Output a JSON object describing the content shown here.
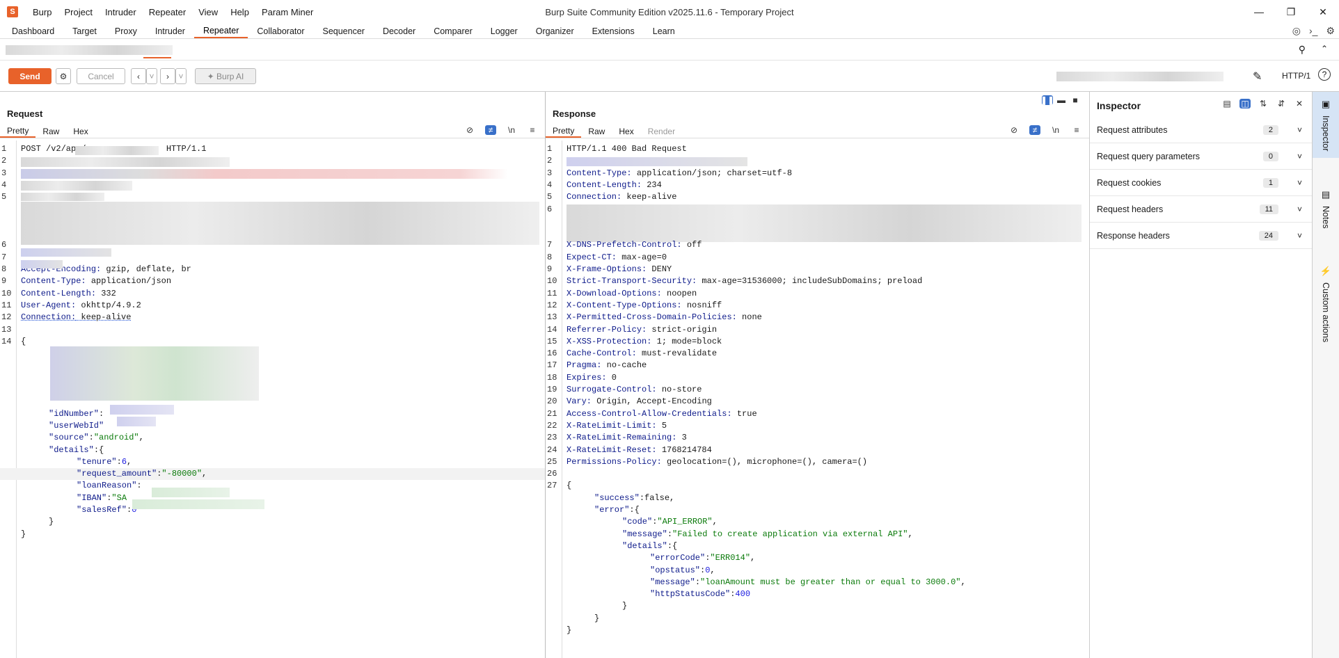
{
  "app": {
    "logo": "S",
    "title": "Burp Suite Community Edition v2025.11.6 - Temporary Project",
    "menu": [
      "Burp",
      "Project",
      "Intruder",
      "Repeater",
      "View",
      "Help",
      "Param Miner"
    ],
    "window_controls": [
      "minimize-icon",
      "restore-icon",
      "close-icon"
    ]
  },
  "main_tabs": [
    "Dashboard",
    "Target",
    "Proxy",
    "Intruder",
    "Repeater",
    "Collaborator",
    "Sequencer",
    "Decoder",
    "Comparer",
    "Logger",
    "Organizer",
    "Extensions",
    "Learn"
  ],
  "active_main_tab": "Repeater",
  "toolbar": {
    "send": "Send",
    "cancel": "Cancel",
    "burp_ai": "Burp AI",
    "protocol": "HTTP/1"
  },
  "request": {
    "heading": "Request",
    "tabs": [
      "Pretty",
      "Raw",
      "Hex"
    ],
    "active_tab": "Pretty",
    "icon_labels": {
      "newline": "\\n"
    },
    "lines": [
      {
        "n": "1",
        "t": "POST /v2/app/                HTTP/1.1"
      },
      {
        "n": "2",
        "t": ""
      },
      {
        "n": "3",
        "t": ""
      },
      {
        "n": "4",
        "t": ""
      },
      {
        "n": "5",
        "t": ""
      },
      {
        "n": "6",
        "t": ""
      },
      {
        "n": "7",
        "t": ""
      },
      {
        "n": "8",
        "k": "Accept-Encoding:",
        "v": " gzip, deflate, br"
      },
      {
        "n": "9",
        "k": "Content-Type:",
        "v": " application/json"
      },
      {
        "n": "10",
        "k": "Content-Length:",
        "v": " 332"
      },
      {
        "n": "11",
        "k": "User-Agent:",
        "v": " okhttp/4.9.2"
      },
      {
        "n": "12",
        "k": "Connection:",
        "v": " keep-alive"
      },
      {
        "n": "13",
        "t": ""
      },
      {
        "n": "14",
        "t": "{"
      }
    ],
    "body_lines": [
      {
        "indent": 1,
        "k": "\"idNumber\"",
        "v": ":"
      },
      {
        "indent": 1,
        "k": "\"userWebId\"",
        "v": ""
      },
      {
        "indent": 1,
        "k": "\"source\"",
        "v": ":",
        "s": "\"android\"",
        "e": ","
      },
      {
        "indent": 1,
        "k": "\"details\"",
        "v": ":{"
      },
      {
        "indent": 2,
        "k": "\"tenure\"",
        "v": ":",
        "num": "6",
        "e": ","
      },
      {
        "indent": 2,
        "k": "\"request_amount\"",
        "v": ":",
        "s": "\"-80000\"",
        "e": ","
      },
      {
        "indent": 2,
        "k": "\"loanReason\"",
        "v": ":"
      },
      {
        "indent": 2,
        "k": "\"IBAN\"",
        "v": ":",
        "s": "\"SA"
      },
      {
        "indent": 2,
        "k": "\"salesRef\"",
        "v": ":",
        "num": "0"
      },
      {
        "indent": 1,
        "t": "}"
      },
      {
        "indent": 0,
        "t": "}"
      }
    ]
  },
  "response": {
    "heading": "Response",
    "tabs": [
      "Pretty",
      "Raw",
      "Hex",
      "Render"
    ],
    "active_tab": "Pretty",
    "icon_labels": {
      "newline": "\\n"
    },
    "status_line": "HTTP/1.1 400 Bad Request",
    "headers": [
      {
        "n": "3",
        "k": "Content-Type:",
        "v": " application/json; charset=utf-8"
      },
      {
        "n": "4",
        "k": "Content-Length:",
        "v": " 234"
      },
      {
        "n": "5",
        "k": "Connection:",
        "v": " keep-alive"
      },
      {
        "n": "7",
        "k": "X-DNS-Prefetch-Control:",
        "v": " off"
      },
      {
        "n": "8",
        "k": "Expect-CT:",
        "v": " max-age=0"
      },
      {
        "n": "9",
        "k": "X-Frame-Options:",
        "v": " DENY"
      },
      {
        "n": "10",
        "k": "Strict-Transport-Security:",
        "v": " max-age=31536000; includeSubDomains; preload"
      },
      {
        "n": "11",
        "k": "X-Download-Options:",
        "v": " noopen"
      },
      {
        "n": "12",
        "k": "X-Content-Type-Options:",
        "v": " nosniff"
      },
      {
        "n": "13",
        "k": "X-Permitted-Cross-Domain-Policies:",
        "v": " none"
      },
      {
        "n": "14",
        "k": "Referrer-Policy:",
        "v": " strict-origin"
      },
      {
        "n": "15",
        "k": "X-XSS-Protection:",
        "v": " 1; mode=block"
      },
      {
        "n": "16",
        "k": "Cache-Control:",
        "v": " must-revalidate"
      },
      {
        "n": "17",
        "k": "Pragma:",
        "v": " no-cache"
      },
      {
        "n": "18",
        "k": "Expires:",
        "v": " 0"
      },
      {
        "n": "19",
        "k": "Surrogate-Control:",
        "v": " no-store"
      },
      {
        "n": "20",
        "k": "Vary:",
        "v": " Origin, Accept-Encoding"
      },
      {
        "n": "21",
        "k": "Access-Control-Allow-Credentials:",
        "v": " true"
      },
      {
        "n": "22",
        "k": "X-RateLimit-Limit:",
        "v": " 5"
      },
      {
        "n": "23",
        "k": "X-RateLimit-Remaining:",
        "v": " 3"
      },
      {
        "n": "24",
        "k": "X-RateLimit-Reset:",
        "v": " 1768214784"
      },
      {
        "n": "25",
        "k": "Permissions-Policy:",
        "v": " geolocation=(), microphone=(), camera=()"
      }
    ],
    "body": [
      {
        "n": "27",
        "indent": 0,
        "t": "{"
      },
      {
        "indent": 1,
        "k": "\"success\"",
        "v": ":",
        "kw": "false",
        "e": ","
      },
      {
        "indent": 1,
        "k": "\"error\"",
        "v": ":{"
      },
      {
        "indent": 2,
        "k": "\"code\"",
        "v": ":",
        "s": "\"API_ERROR\"",
        "e": ","
      },
      {
        "indent": 2,
        "k": "\"message\"",
        "v": ":",
        "s": "\"Failed to create application via external API\"",
        "e": ","
      },
      {
        "indent": 2,
        "k": "\"details\"",
        "v": ":{"
      },
      {
        "indent": 3,
        "k": "\"errorCode\"",
        "v": ":",
        "s": "\"ERR014\"",
        "e": ","
      },
      {
        "indent": 3,
        "k": "\"opstatus\"",
        "v": ":",
        "num": "0",
        "e": ","
      },
      {
        "indent": 3,
        "k": "\"message\"",
        "v": ":",
        "s": "\"loanAmount must be greater than or equal to 3000.0\"",
        "e": ","
      },
      {
        "indent": 3,
        "k": "\"httpStatusCode\"",
        "v": ":",
        "num": "400"
      },
      {
        "indent": 2,
        "t": "}"
      },
      {
        "indent": 1,
        "t": "}"
      },
      {
        "indent": 0,
        "t": "}"
      }
    ]
  },
  "inspector": {
    "title": "Inspector",
    "rows": [
      {
        "label": "Request attributes",
        "count": "2"
      },
      {
        "label": "Request query parameters",
        "count": "0"
      },
      {
        "label": "Request cookies",
        "count": "1"
      },
      {
        "label": "Request headers",
        "count": "11"
      },
      {
        "label": "Response headers",
        "count": "24"
      }
    ]
  },
  "side_tabs": [
    "Inspector",
    "Notes",
    "Custom actions"
  ],
  "colors": {
    "accent": "#e8622a",
    "header_key": "#0d1a8a",
    "string": "#0a7a0a",
    "number": "#1a1ae0",
    "toggle_on": "#3970c9"
  }
}
